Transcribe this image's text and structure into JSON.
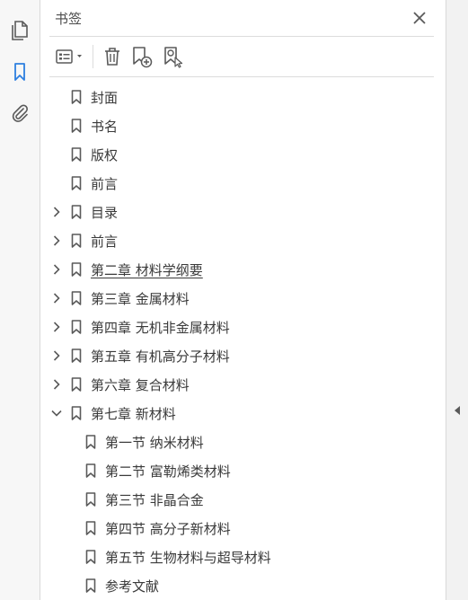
{
  "panel": {
    "title": "书签"
  },
  "icons": {
    "pages": "pages-icon",
    "bookmarks": "bookmark-icon",
    "attachments": "paperclip-icon",
    "close": "close-icon",
    "options": "options-menu-icon",
    "delete": "trash-icon",
    "new_bookmark": "add-bookmark-icon",
    "find_bookmark": "find-bookmark-icon",
    "collapse": "triangle-left-icon"
  },
  "colors": {
    "accent": "#2d7fe0",
    "icon": "#5a5a5a",
    "text": "#3a3a3a"
  },
  "bookmarks": [
    {
      "label": "封面",
      "level": 0,
      "expander": "none"
    },
    {
      "label": "书名",
      "level": 0,
      "expander": "none"
    },
    {
      "label": "版权",
      "level": 0,
      "expander": "none"
    },
    {
      "label": "前言",
      "level": 0,
      "expander": "none"
    },
    {
      "label": "目录",
      "level": 0,
      "expander": "collapsed"
    },
    {
      "label": "前言",
      "level": 0,
      "expander": "collapsed"
    },
    {
      "label": "第二章 材料学纲要",
      "level": 0,
      "expander": "collapsed",
      "underline": true
    },
    {
      "label": "第三章 金属材料",
      "level": 0,
      "expander": "collapsed"
    },
    {
      "label": "第四章 无机非金属材料",
      "level": 0,
      "expander": "collapsed"
    },
    {
      "label": "第五章 有机高分子材料",
      "level": 0,
      "expander": "collapsed"
    },
    {
      "label": "第六章 复合材料",
      "level": 0,
      "expander": "collapsed"
    },
    {
      "label": "第七章 新材料",
      "level": 0,
      "expander": "expanded"
    },
    {
      "label": "第一节 纳米材料",
      "level": 1,
      "expander": "none"
    },
    {
      "label": "第二节 富勒烯类材料",
      "level": 1,
      "expander": "none"
    },
    {
      "label": "第三节 非晶合金",
      "level": 1,
      "expander": "none"
    },
    {
      "label": "第四节 高分子新材料",
      "level": 1,
      "expander": "none"
    },
    {
      "label": "第五节 生物材料与超导材料",
      "level": 1,
      "expander": "none"
    },
    {
      "label": "参考文献",
      "level": 1,
      "expander": "none"
    }
  ]
}
